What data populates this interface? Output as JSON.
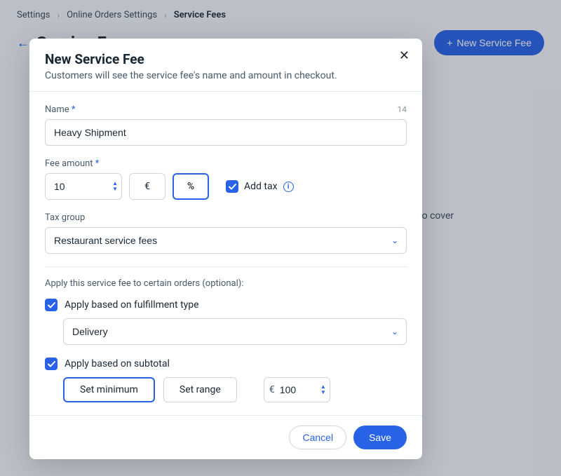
{
  "breadcrumb": {
    "item1": "Settings",
    "item2": "Online Orders Settings",
    "item3": "Service Fees"
  },
  "page": {
    "title": "Service Fees",
    "new_button": "New Service Fee",
    "bg_hint": "types to cover"
  },
  "modal": {
    "title": "New Service Fee",
    "subtitle": "Customers will see the service fee's name and amount in checkout.",
    "name": {
      "label": "Name",
      "value": "Heavy Shipment",
      "count": "14"
    },
    "fee": {
      "label": "Fee amount",
      "value": "10",
      "currency_symbol": "€",
      "percent_symbol": "%",
      "addtax_label": "Add tax"
    },
    "tax_group": {
      "label": "Tax group",
      "value": "Restaurant service fees"
    },
    "apply_section_label": "Apply this service fee to certain orders (optional):",
    "fulfillment": {
      "label": "Apply based on fulfillment type",
      "value": "Delivery"
    },
    "subtotal": {
      "label": "Apply based on subtotal",
      "set_min": "Set minimum",
      "set_range": "Set range",
      "currency": "€",
      "value": "100"
    },
    "footer": {
      "cancel": "Cancel",
      "save": "Save"
    }
  }
}
